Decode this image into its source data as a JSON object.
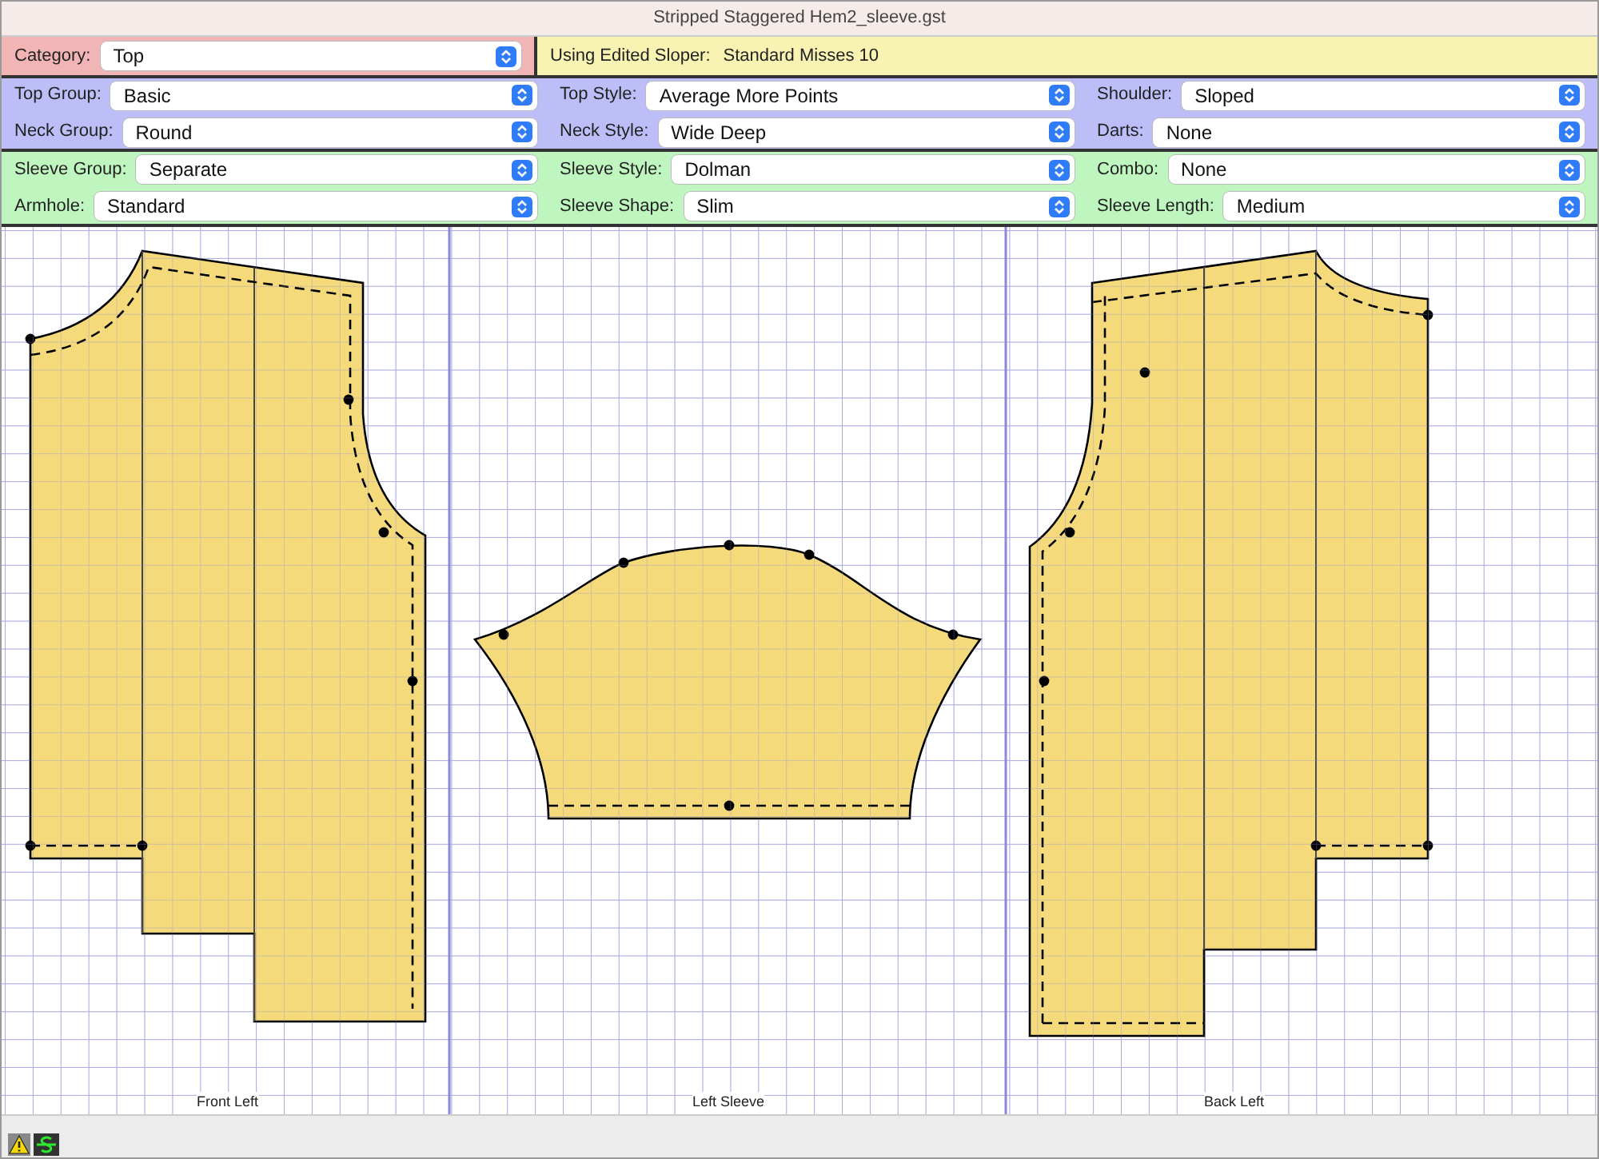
{
  "window": {
    "title": "Stripped Staggered Hem2_sleeve.gst"
  },
  "category": {
    "label": "Category:",
    "value": "Top"
  },
  "sloper": {
    "label": "Using Edited Sloper:",
    "value": "Standard Misses 10"
  },
  "top_fields": [
    {
      "label": "Top Group:",
      "value": "Basic"
    },
    {
      "label": "Top Style:",
      "value": "Average More Points"
    },
    {
      "label": "Shoulder:",
      "value": "Sloped"
    },
    {
      "label": "Neck Group:",
      "value": "Round"
    },
    {
      "label": "Neck Style:",
      "value": "Wide Deep"
    },
    {
      "label": "Darts:",
      "value": "None"
    }
  ],
  "sleeve_fields": [
    {
      "label": "Sleeve Group:",
      "value": "Separate"
    },
    {
      "label": "Sleeve Style:",
      "value": "Dolman"
    },
    {
      "label": "Combo:",
      "value": "None"
    },
    {
      "label": "Armhole:",
      "value": "Standard"
    },
    {
      "label": "Sleeve Shape:",
      "value": "Slim"
    },
    {
      "label": "Sleeve Length:",
      "value": "Medium"
    }
  ],
  "pieces": [
    {
      "kind": "front",
      "label": "Front Left"
    },
    {
      "kind": "sleeve",
      "label": "Left Sleeve"
    },
    {
      "kind": "back",
      "label": "Back Left"
    }
  ]
}
